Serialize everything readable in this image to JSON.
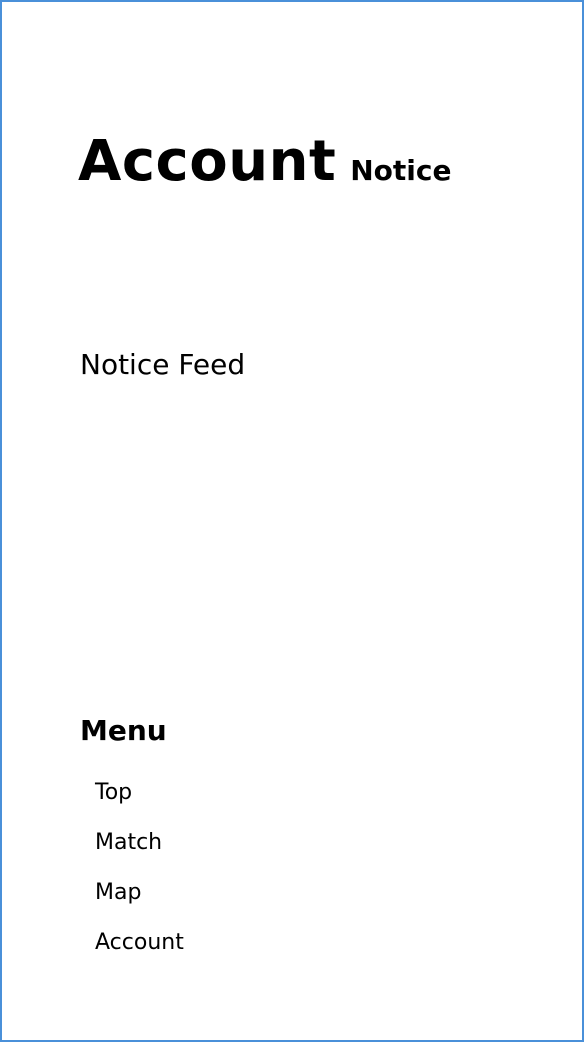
{
  "header": {
    "title": "Account",
    "subtitle": "Notice"
  },
  "feed": {
    "title": "Notice Feed"
  },
  "menu": {
    "title": "Menu",
    "items": [
      {
        "label": "Top"
      },
      {
        "label": "Match"
      },
      {
        "label": "Map"
      },
      {
        "label": "Account"
      }
    ]
  },
  "colors": {
    "frame_border": "#4a90d9",
    "background": "#ffffff",
    "text": "#000000"
  }
}
